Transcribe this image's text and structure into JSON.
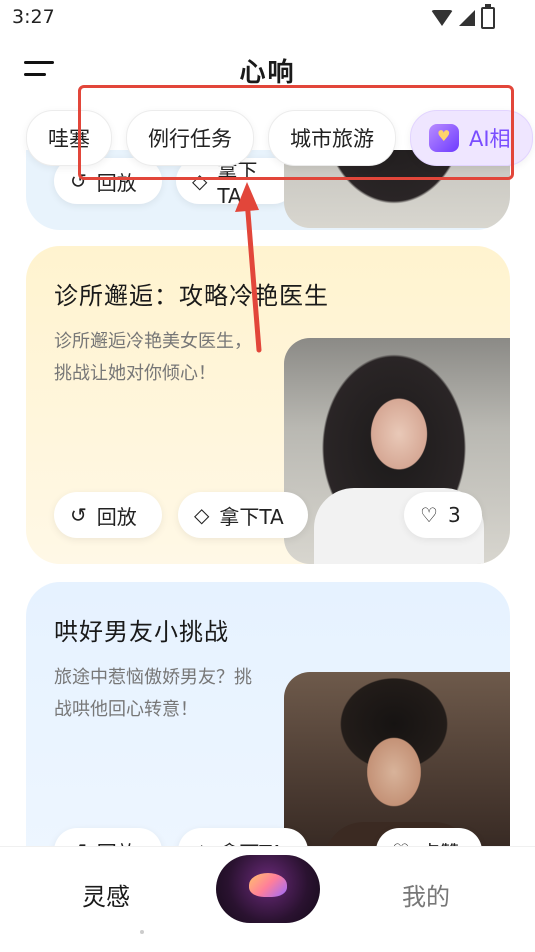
{
  "status_bar": {
    "time": "3:27"
  },
  "header": {
    "title": "心响"
  },
  "tabs": [
    {
      "label": "哇塞"
    },
    {
      "label": "例行任务"
    },
    {
      "label": "城市旅游"
    },
    {
      "label": "AI相"
    }
  ],
  "cards": [
    {
      "title": "诊所邂逅：攻略冷艳医生",
      "description": "诊所邂逅冷艳美女医生，挑战让她对你倾心！",
      "replay_label": "回放",
      "take_label": "拿下TA",
      "likes": "3"
    },
    {
      "title": "哄好男友小挑战",
      "description": "旅途中惹恼傲娇男友？挑战哄他回心转意！",
      "replay_label": "回放",
      "take_label": "拿下TA",
      "like_label": "点赞"
    }
  ],
  "top_card": {
    "replay_label": "回放",
    "take_label": "拿下TA"
  },
  "bottom_nav": {
    "left": "灵感",
    "right": "我的"
  },
  "colors": {
    "annotation": "#e2463a",
    "ai_accent": "#7a4dff"
  }
}
